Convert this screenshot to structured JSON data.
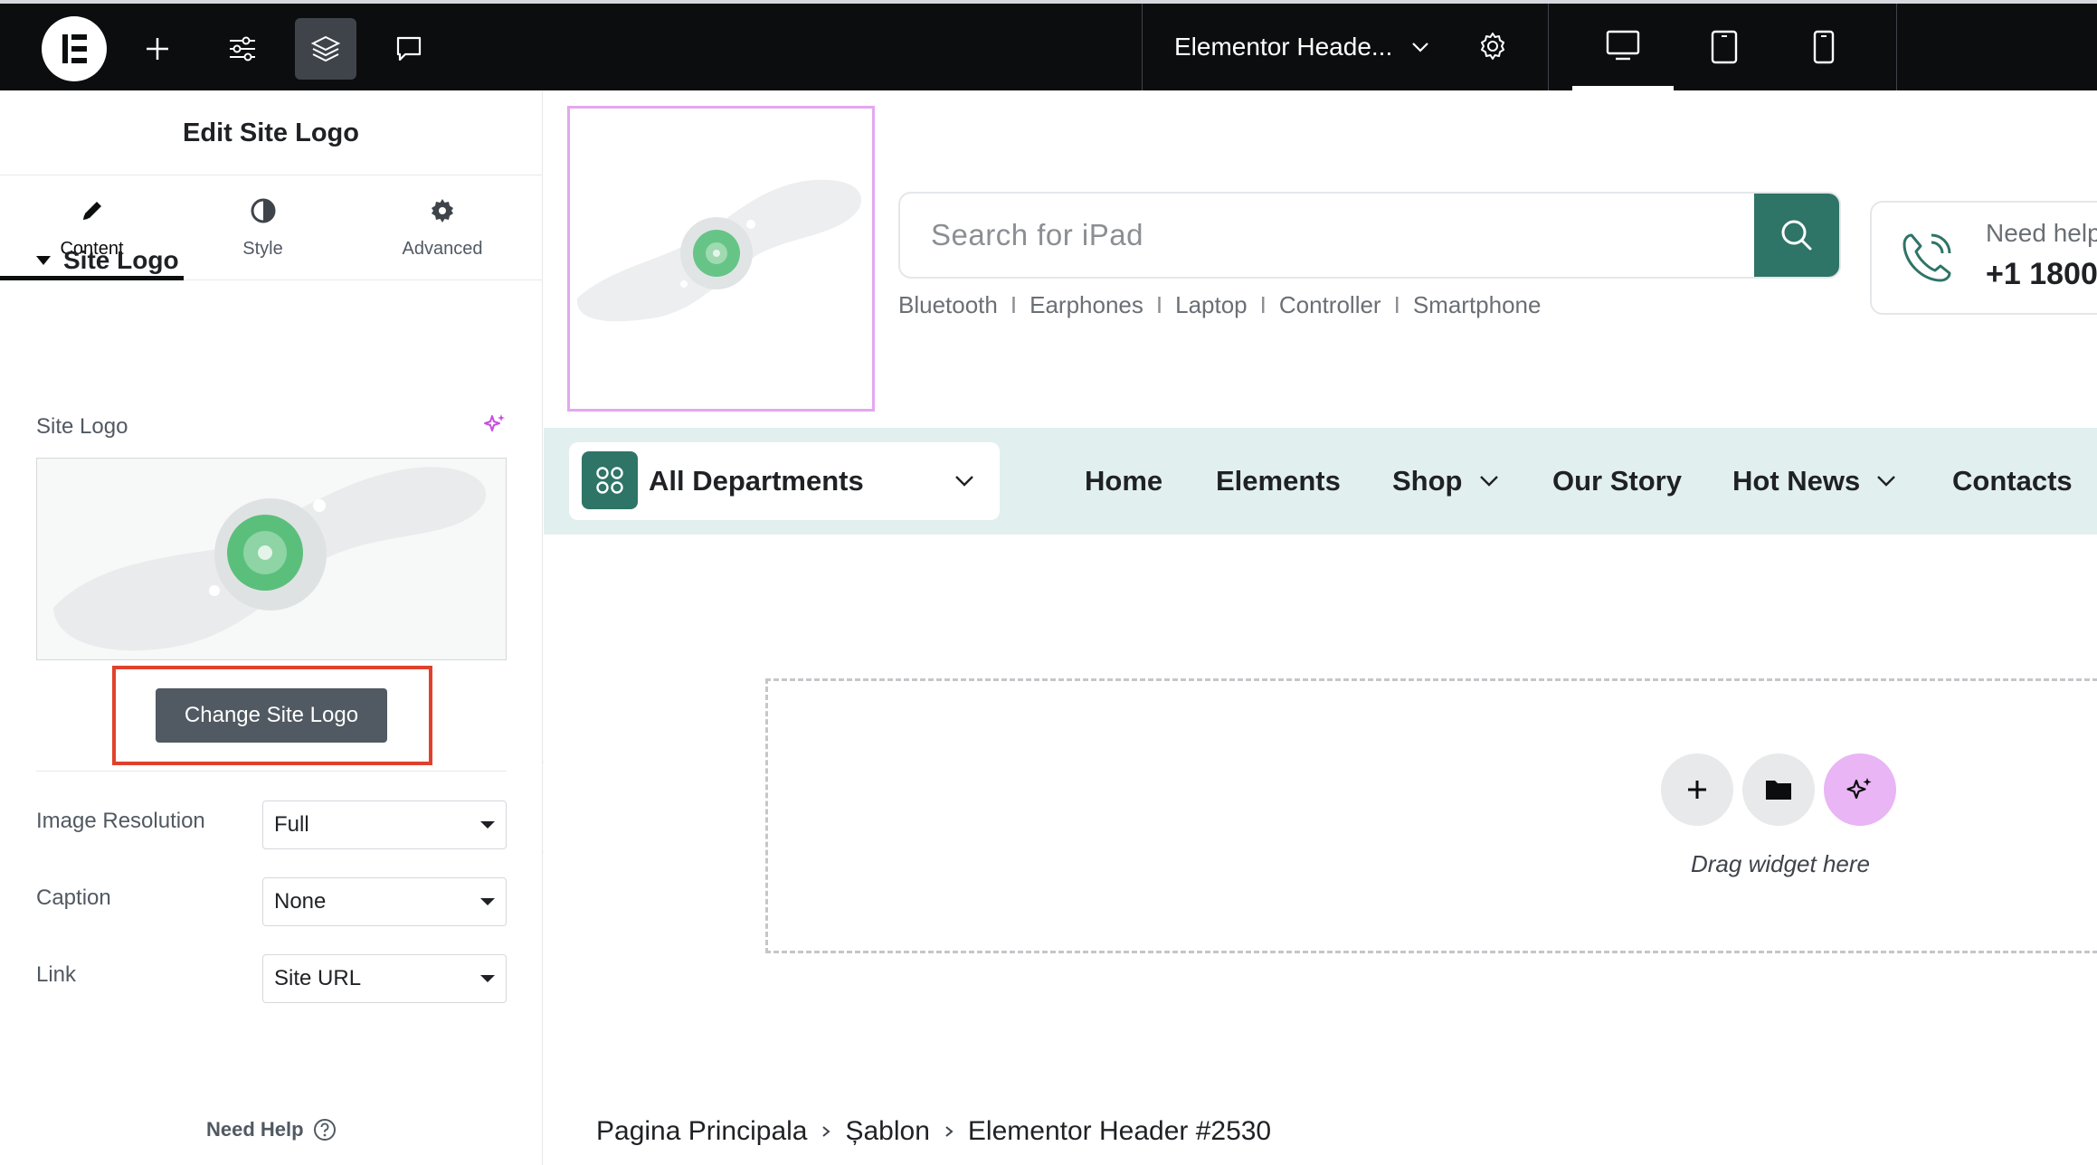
{
  "topbar": {
    "document_title": "Elementor Heade...",
    "icons": [
      "elementor-logo-icon",
      "add-icon",
      "settings-sliders-icon",
      "layers-icon",
      "comment-icon",
      "chevron-down-icon",
      "gear-icon",
      "desktop-icon",
      "tablet-icon",
      "mobile-icon"
    ]
  },
  "panel": {
    "title": "Edit Site Logo",
    "tabs": [
      {
        "label": "Content",
        "icon": "pencil-icon",
        "active": true
      },
      {
        "label": "Style",
        "icon": "half-circle-icon",
        "active": false
      },
      {
        "label": "Advanced",
        "icon": "gear-icon",
        "active": false
      }
    ],
    "section_title": "Site Logo",
    "site_logo_label": "Site Logo",
    "change_button": "Change Site Logo",
    "fields": [
      {
        "label": "Image Resolution",
        "value": "Full"
      },
      {
        "label": "Caption",
        "value": "None"
      },
      {
        "label": "Link",
        "value": "Site URL"
      }
    ],
    "need_help": "Need Help"
  },
  "preview": {
    "search_placeholder": "Search for iPad",
    "tags": [
      "Bluetooth",
      "Earphones",
      "Laptop",
      "Controller",
      "Smartphone"
    ],
    "tag_separator": "I",
    "help_question": "Need help",
    "help_phone": "+1 1800",
    "departments_label": "All Departments",
    "nav": [
      {
        "label": "Home",
        "dropdown": false
      },
      {
        "label": "Elements",
        "dropdown": false
      },
      {
        "label": "Shop",
        "dropdown": true
      },
      {
        "label": "Our Story",
        "dropdown": false
      },
      {
        "label": "Hot News",
        "dropdown": true
      },
      {
        "label": "Contacts",
        "dropdown": false
      }
    ],
    "drop_text": "Drag widget here",
    "breadcrumb": [
      "Pagina Principala",
      "Șablon",
      "Elementor Header #2530"
    ],
    "colors": {
      "accent": "#2e7467",
      "nav_bg": "#e2efef",
      "ai_purple": "#e9b5f5",
      "highlight_red": "#e0412c"
    }
  }
}
